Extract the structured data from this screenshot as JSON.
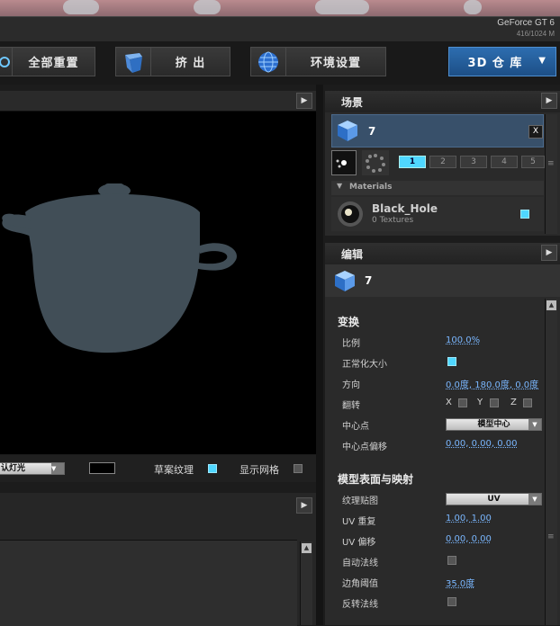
{
  "gpu": {
    "name": "GeForce GT 6",
    "memory": "416/1024 M"
  },
  "toolbar": {
    "reset_label": "全部重置",
    "extrude_label": "挤 出",
    "env_label": "环境设置",
    "repo_label": "3D 仓 库"
  },
  "viewport": {
    "light_select": "认灯光",
    "draft_texture_label": "草案纹理",
    "show_grid_label": "显示网格",
    "draft_texture_checked": true,
    "show_grid_checked": false
  },
  "scene": {
    "title": "场景",
    "object_name": "7",
    "close_label": "X",
    "layer_tabs": [
      "1",
      "2",
      "3",
      "4",
      "5"
    ],
    "active_layer": "1",
    "materials_label": "Materials",
    "material_name": "Black_Hole",
    "material_textures": "0 Textures"
  },
  "edit": {
    "title": "编辑",
    "object_name": "7",
    "transform_title": "变换",
    "scale_label": "比例",
    "scale_value": "100.0%",
    "normalize_label": "正常化大小",
    "direction_label": "方向",
    "direction_value": "0.0度, 180.0度, 0.0度",
    "flip_label": "翻转",
    "flip_x": "X",
    "flip_y": "Y",
    "flip_z": "Z",
    "pivot_label": "中心点",
    "pivot_value": "模型中心",
    "pivot_offset_label": "中心点偏移",
    "pivot_offset_value": "0.00, 0.00, 0.00",
    "surface_title": "模型表面与映射",
    "texmap_label": "纹理贴图",
    "texmap_value": "UV",
    "uv_repeat_label": "UV 重复",
    "uv_repeat_value": "1.00, 1.00",
    "uv_offset_label": "UV 偏移",
    "uv_offset_value": "0.00, 0.00",
    "auto_normal_label": "自动法线",
    "edge_threshold_label": "边角阈值",
    "edge_threshold_value": "35.0度",
    "flip_normal_label": "反转法线"
  },
  "colors": {
    "accent": "#4fd7ff",
    "repo_button": "#2d6db0",
    "pot": "#414e57"
  }
}
